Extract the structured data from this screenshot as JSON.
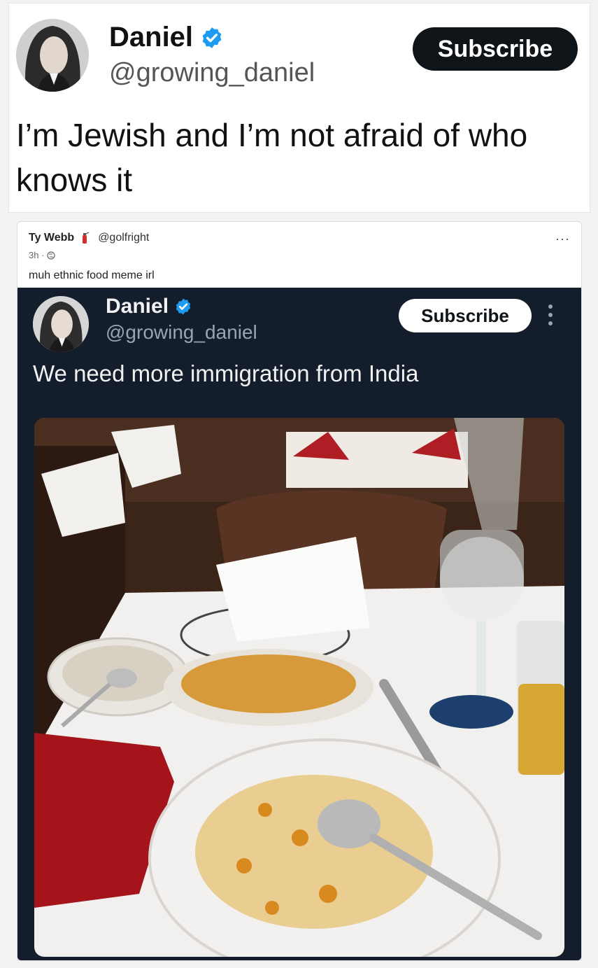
{
  "top_tweet": {
    "name": "Daniel",
    "handle": "@growing_daniel",
    "subscribe_label": "Subscribe",
    "text": "I’m Jewish and I’m not afraid of who knows it",
    "verified_icon": "verified-badge-icon"
  },
  "quote_post": {
    "name": "Ty Webb",
    "handle": "@golfright",
    "time": "3h ·",
    "text": "muh ethnic food meme irl",
    "more_label": "···",
    "embedded_tweet": {
      "name": "Daniel",
      "handle": "@growing_daniel",
      "subscribe_label": "Subscribe",
      "text": "We need more immigration from India"
    }
  },
  "colors": {
    "verified_blue": "#1d9bf0",
    "dark_background": "#141d2b",
    "subscribe_dark": "#0f1419"
  }
}
